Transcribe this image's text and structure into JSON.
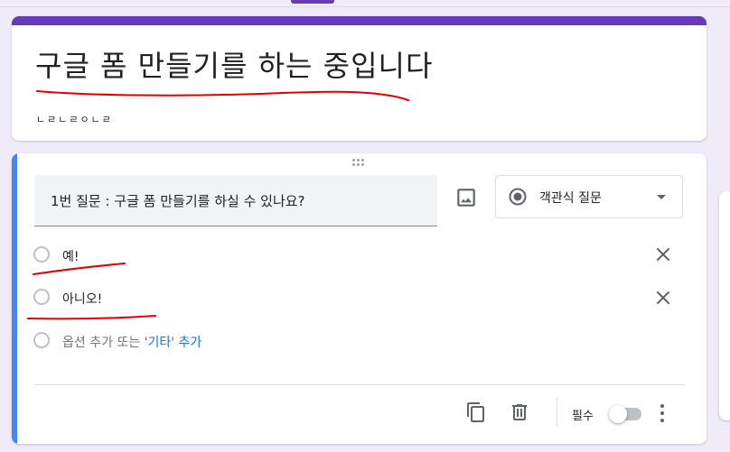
{
  "form": {
    "title": "구글 폼 만들기를 하는 중입니다",
    "description": "ㄴㄹㄴㄹㅇㄴㄹ"
  },
  "question": {
    "title": "1번 질문 : 구글 폼 만들기를 하실 수 있나요?",
    "type_label": "객관식 질문",
    "options": [
      {
        "label": "예!"
      },
      {
        "label": "아니오!"
      }
    ],
    "add_option": {
      "prefix": "옵션 추가 또는 ",
      "other_link": "'기타' 추가"
    },
    "required_label": "필수",
    "required": false
  },
  "icons": {
    "image": "image-icon",
    "type_radio": "radio-button-checked-icon",
    "dropdown": "caret-down-icon",
    "remove": "close-icon",
    "duplicate": "copy-icon",
    "delete": "trash-icon",
    "more": "more-vert-icon",
    "drag": "drag-handle-icon"
  },
  "colors": {
    "theme": "#673ab7",
    "active_accent": "#4285f4",
    "page_bg": "#f0ebf8",
    "link": "#1a73e8",
    "annotation_ink": "#e00000"
  }
}
